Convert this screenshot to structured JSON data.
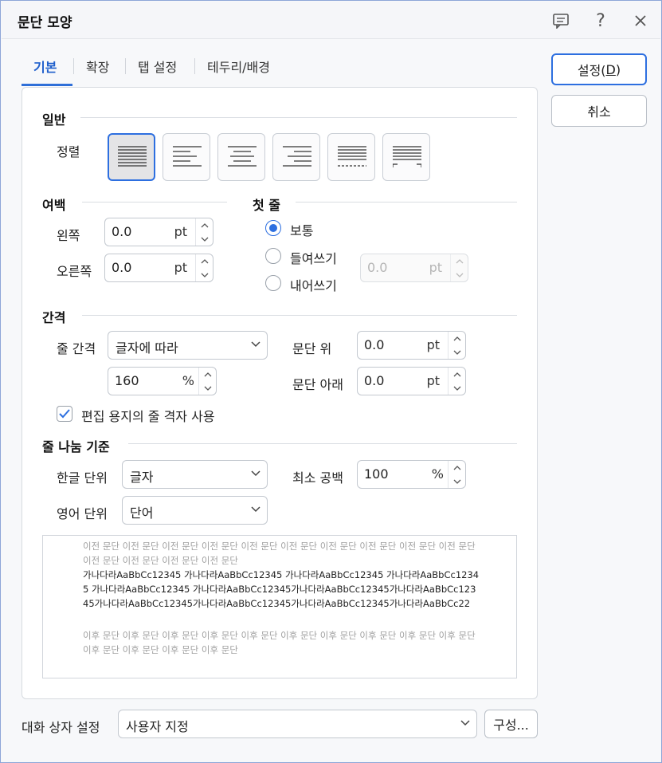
{
  "window": {
    "title": "문단 모양"
  },
  "tabs": [
    {
      "label": "기본"
    },
    {
      "label": "확장"
    },
    {
      "label": "탭 설정"
    },
    {
      "label": "테두리/배경"
    }
  ],
  "general": {
    "title": "일반",
    "align_label": "정렬",
    "align_options": [
      "justify",
      "left",
      "center",
      "right",
      "distribute",
      "split"
    ],
    "selected_align": "justify"
  },
  "margin": {
    "title": "여백",
    "left_label": "왼쪽",
    "left_value": "0.0",
    "left_unit": "pt",
    "right_label": "오른쪽",
    "right_value": "0.0",
    "right_unit": "pt"
  },
  "first_line": {
    "title": "첫 줄",
    "options": [
      "보통",
      "들여쓰기",
      "내어쓰기"
    ],
    "selected": "보통",
    "value": "0.0",
    "unit": "pt"
  },
  "spacing": {
    "title": "간격",
    "line_label": "줄 간격",
    "line_type": "글자에 따라",
    "line_value": "160",
    "line_unit": "%",
    "above_label": "문단 위",
    "above_value": "0.0",
    "above_unit": "pt",
    "below_label": "문단 아래",
    "below_value": "0.0",
    "below_unit": "pt",
    "grid_checkbox_label": "편집 용지의 줄 격자 사용",
    "grid_checked": true
  },
  "line_break": {
    "title": "줄 나눔 기준",
    "korean_label": "한글 단위",
    "korean_value": "글자",
    "english_label": "영어 단위",
    "english_value": "단어",
    "min_space_label": "최소 공백",
    "min_space_value": "100",
    "min_space_unit": "%"
  },
  "preview": {
    "prev_text": "이전 문단 이전 문단 이전 문단 이전 문단 이전 문단 이전 문단 이전 문단 이전 문단 이전 문단 이전 문단 이전 문단 이전 문단 이전 문단 이전 문단",
    "cur_text": "가나다라AaBbCc12345 가나다라AaBbCc12345 가나다라AaBbCc12345 가나다라AaBbCc12345 가나다라AaBbCc12345 가나다라AaBbCc12345가나다라AaBbCc12345가나다라AaBbCc12345가나다라AaBbCc12345가나다라AaBbCc12345가나다라AaBbCc12345가나다라AaBbCc22",
    "next_text": "이후 문단 이후 문단 이후 문단 이후 문단 이후 문단 이후 문단 이후 문단 이후 문단 이후 문단 이후 문단 이후 문단 이후 문단 이후 문단 이후 문단"
  },
  "footer": {
    "dialog_settings_label": "대화 상자 설정",
    "dialog_settings_value": "사용자 지정",
    "configure_label": "구성..."
  },
  "buttons": {
    "ok_label_prefix": "설정(",
    "ok_label_key": "D",
    "ok_label_suffix": ")",
    "cancel_label": "취소"
  },
  "colors": {
    "accent": "#2d6fe0",
    "tab_active": "#1f5fcc"
  }
}
